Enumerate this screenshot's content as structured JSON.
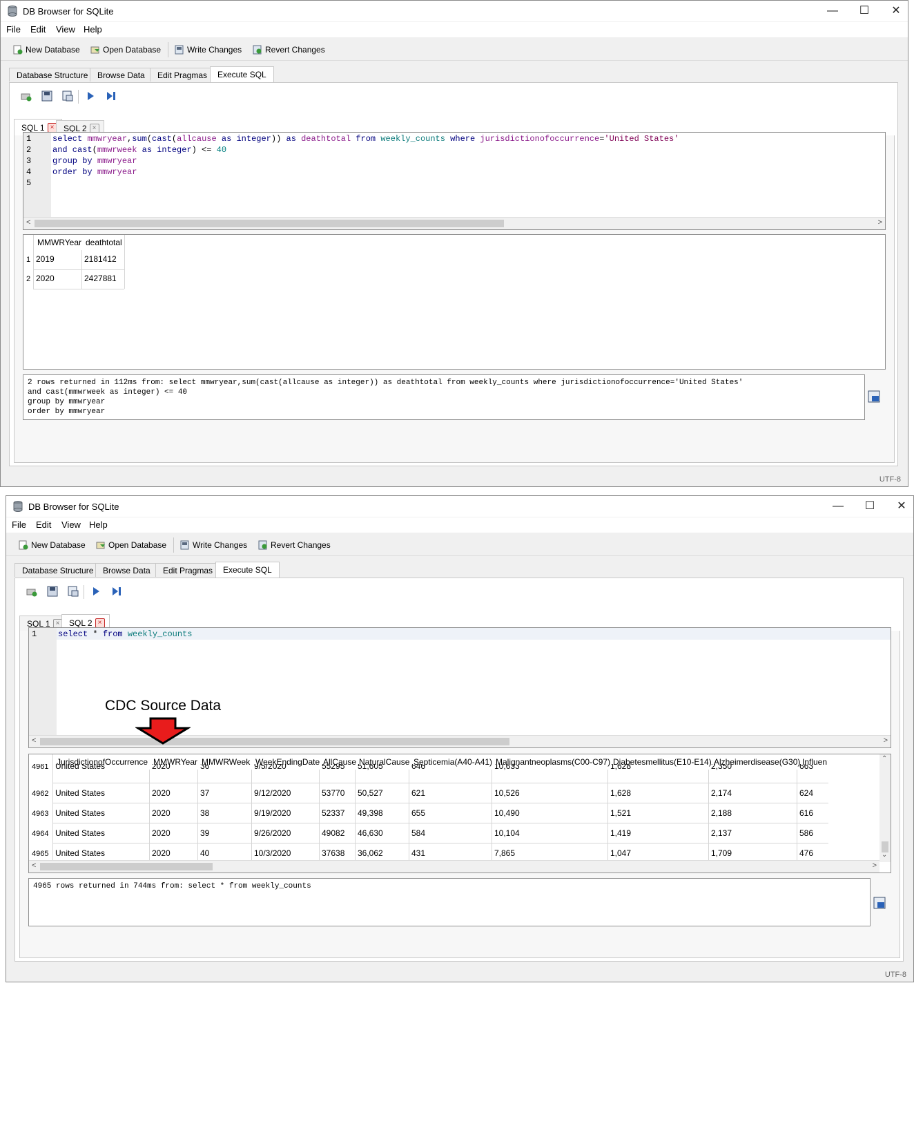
{
  "window1": {
    "title": "DB Browser for SQLite",
    "menu": [
      "File",
      "Edit",
      "View",
      "Help"
    ],
    "toolbar": {
      "new_db": "New Database",
      "open_db": "Open Database",
      "write": "Write Changes",
      "revert": "Revert Changes"
    },
    "tabs": [
      "Database Structure",
      "Browse Data",
      "Edit Pragmas",
      "Execute SQL"
    ],
    "sql_tabs": [
      "SQL 1",
      "SQL 2"
    ],
    "editor_lines": [
      "select mmwryear,sum(cast(allcause as integer)) as deathtotal from weekly_counts where jurisdictionofoccurrence='United States'",
      "and cast(mmwrweek as integer) <= 40",
      "group by mmwryear",
      "order by mmwryear",
      ""
    ],
    "results": {
      "columns": [
        "MMWRYear",
        "deathtotal"
      ],
      "rows": [
        [
          "2019",
          "2181412"
        ],
        [
          "2020",
          "2427881"
        ]
      ]
    },
    "message": "2 rows returned in 112ms from: select mmwryear,sum(cast(allcause as integer)) as deathtotal from weekly_counts where jurisdictionofoccurrence='United States'\nand cast(mmwrweek as integer) <= 40\ngroup by mmwryear\norder by mmwryear",
    "status": "UTF-8"
  },
  "window2": {
    "title": "DB Browser for SQLite",
    "menu": [
      "File",
      "Edit",
      "View",
      "Help"
    ],
    "toolbar": {
      "new_db": "New Database",
      "open_db": "Open Database",
      "write": "Write Changes",
      "revert": "Revert Changes"
    },
    "tabs": [
      "Database Structure",
      "Browse Data",
      "Edit Pragmas",
      "Execute SQL"
    ],
    "sql_tabs": [
      "SQL 1",
      "SQL 2"
    ],
    "editor_lines": [
      "select * from weekly_counts"
    ],
    "annotation": "CDC Source Data",
    "results": {
      "columns": [
        "JurisdictionofOccurrence",
        "MMWRYear",
        "MMWRWeek",
        "WeekEndingDate",
        "AllCause",
        "NaturalCause",
        "Septicemia(A40-A41)",
        "Malignantneoplasms(C00-C97)",
        "Diabetesmellitus(E10-E14)",
        "Alzheimerdisease(G30)",
        "Influen"
      ],
      "rows": [
        [
          "4961",
          "United States",
          "2020",
          "36",
          "9/5/2020",
          "55295",
          "51,605",
          "646",
          "10,633",
          "1,628",
          "2,350",
          "663"
        ],
        [
          "4962",
          "United States",
          "2020",
          "37",
          "9/12/2020",
          "53770",
          "50,527",
          "621",
          "10,526",
          "1,628",
          "2,174",
          "624"
        ],
        [
          "4963",
          "United States",
          "2020",
          "38",
          "9/19/2020",
          "52337",
          "49,398",
          "655",
          "10,490",
          "1,521",
          "2,188",
          "616"
        ],
        [
          "4964",
          "United States",
          "2020",
          "39",
          "9/26/2020",
          "49082",
          "46,630",
          "584",
          "10,104",
          "1,419",
          "2,137",
          "586"
        ],
        [
          "4965",
          "United States",
          "2020",
          "40",
          "10/3/2020",
          "37638",
          "36,062",
          "431",
          "7,865",
          "1,047",
          "1,709",
          "476"
        ]
      ]
    },
    "message": "4965 rows returned in 744ms from: select * from weekly_counts",
    "status": "UTF-8"
  }
}
